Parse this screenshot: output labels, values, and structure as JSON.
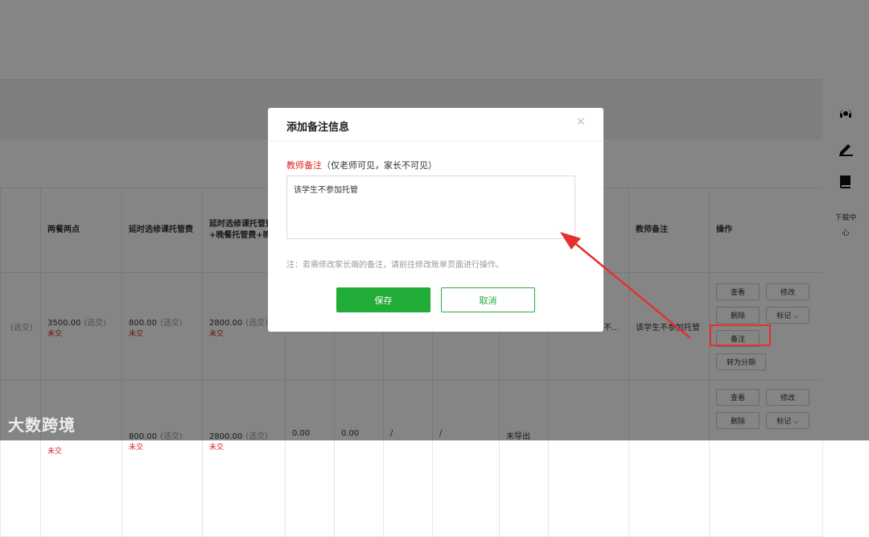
{
  "table": {
    "headers": [
      "两餐两点",
      "延时选修课托管费",
      "延时选修课托管费+晚餐托管费+晚餐",
      "",
      "",
      "",
      "",
      "",
      "",
      "教师备注",
      "操作"
    ],
    "row1": {
      "prev_sel": "(选交)",
      "c1_amount": "3500.00",
      "c1_sel": "(选交)",
      "c1_status": "未交",
      "c2_amount": "800.00",
      "c2_sel": "(选交)",
      "c2_status": "未交",
      "c3_amount": "2800.00",
      "c3_sel": "(选交)",
      "c3_status": "未交",
      "truncated": "了校外托管，不...",
      "teacher_note": "该学生不参加托管"
    },
    "row2": {
      "c1_status": "未交",
      "c2_amount": "800.00",
      "c2_sel": "(选交)",
      "c2_status": "未交",
      "c3_amount": "2800.00",
      "c3_sel": "(选交)",
      "c3_status": "未交",
      "v1": "0.00",
      "v2": "0.00",
      "v3": "/",
      "v4": "/",
      "export": "未导出"
    },
    "ops": {
      "view": "查看",
      "edit": "修改",
      "delete": "删除",
      "mark": "标记",
      "note": "备注",
      "installment": "转为分期"
    }
  },
  "rightbar": {
    "download_label": "下载中心"
  },
  "modal": {
    "title": "添加备注信息",
    "close": "×",
    "label_main": "教师备注",
    "label_hint": "（仅老师可见，家长不可见）",
    "textarea_value": "该学生不参加托管",
    "note": "注：若需修改家长端的备注，请前往修改账单页面进行操作。",
    "save": "保存",
    "cancel": "取消"
  },
  "watermark": "大数跨境",
  "colors": {
    "accent": "#22ac38",
    "danger": "#e02020",
    "annotation": "#e53030"
  },
  "icons": [
    "headset-icon",
    "pen-icon",
    "book-icon",
    "chevron-down-icon",
    "close-icon"
  ]
}
